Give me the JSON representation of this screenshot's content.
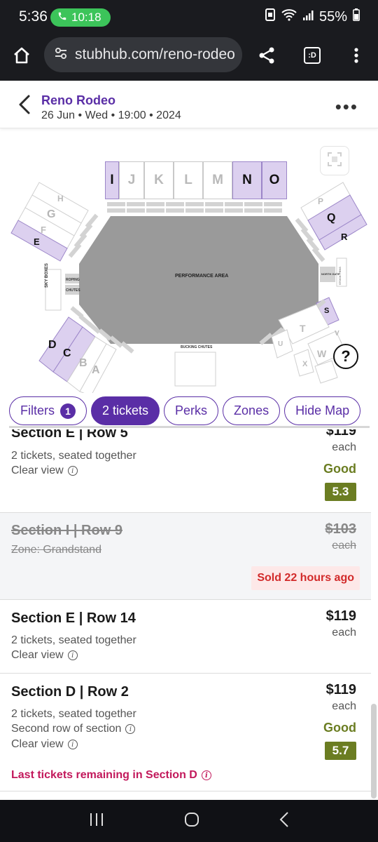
{
  "status_bar": {
    "time": "5:36",
    "call_time": "10:18",
    "battery": "55%"
  },
  "browser": {
    "url": "stubhub.com/reno-rodeo",
    "tabs_label": ":D"
  },
  "event": {
    "title": "Reno Rodeo",
    "subtitle": "26 Jun • Wed • 19:00 • 2024"
  },
  "map": {
    "top_sections": [
      "I",
      "J",
      "K",
      "L",
      "M",
      "N",
      "O"
    ],
    "labels": {
      "performance_area": "PERFORMANCE AREA",
      "sky_boxes": "SKY BOXES",
      "roping": "ROPING",
      "chutes": "CHUTES",
      "bucking_chutes": "BUCKING CHUTES",
      "north_gate": "NORTH GATE",
      "stock_pens": "STOCK PENS"
    },
    "left_sections": [
      "H",
      "G",
      "F",
      "E"
    ],
    "right_sections": [
      "P",
      "Q",
      "R",
      "S"
    ],
    "bottom_left_sections": [
      "D",
      "C",
      "B",
      "A"
    ],
    "bottom_right_sections": [
      "T",
      "U",
      "V",
      "W",
      "X"
    ],
    "help": "?",
    "colors": {
      "highlight": "#dcd0ef",
      "arena": "#9a9a9a",
      "accent": "#5a2ea6"
    }
  },
  "filters": {
    "chips": [
      {
        "label": "Filters",
        "count": "1"
      },
      {
        "label": "2 tickets"
      },
      {
        "label": "Perks"
      },
      {
        "label": "Zones"
      },
      {
        "label": "Hide Map"
      }
    ]
  },
  "listings": [
    {
      "title": "Section E | Row 5",
      "line1": "2 tickets, seated together",
      "line2": "Clear view",
      "price": "$119",
      "each": "each",
      "rating": "Good",
      "score": "5.3"
    },
    {
      "title": "Section I | Row 9",
      "line1": "Zone: Grandstand",
      "price": "$103",
      "each": "each",
      "sold": "Sold 22 hours ago"
    },
    {
      "title": "Section E | Row 14",
      "line1": "2 tickets, seated together",
      "line2": "Clear view",
      "price": "$119",
      "each": "each"
    },
    {
      "title": "Section D | Row 2",
      "line1": "2 tickets, seated together",
      "line2": "Second row of section",
      "line3": "Clear view",
      "price": "$119",
      "each": "each",
      "rating": "Good",
      "score": "5.7",
      "alert": "Last tickets remaining in Section D"
    }
  ]
}
